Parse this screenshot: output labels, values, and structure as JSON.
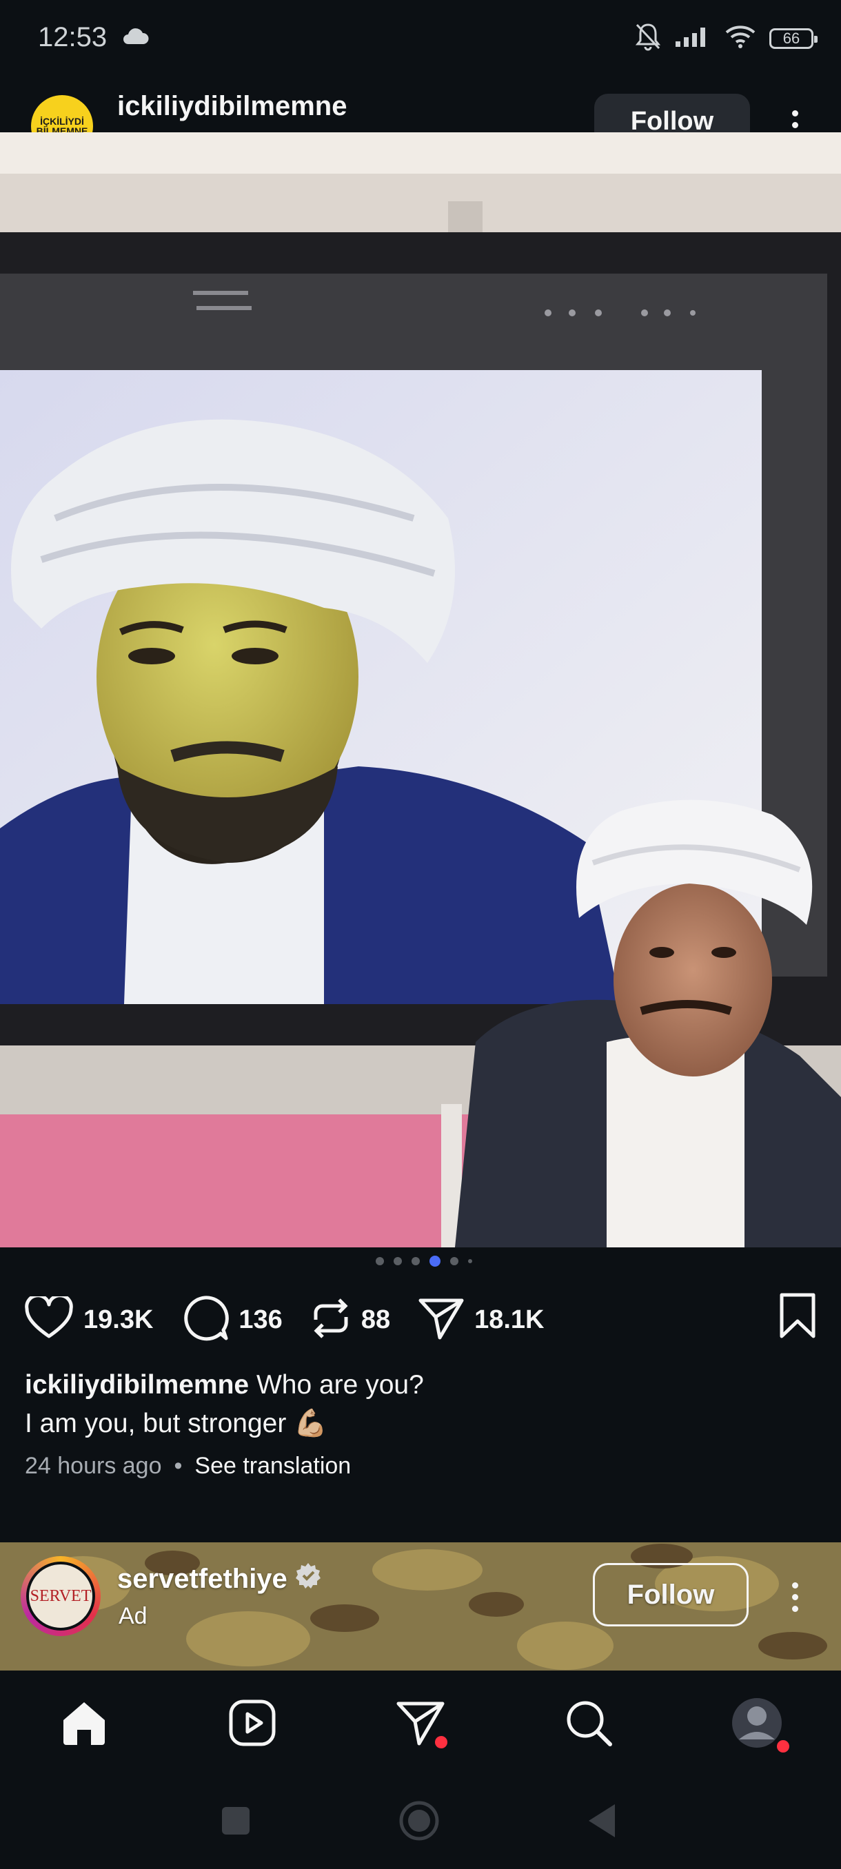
{
  "status_bar": {
    "time": "12:53",
    "battery": "66",
    "icons": [
      "cloud-icon",
      "bell-off-icon",
      "signal-icon",
      "wifi-icon",
      "battery-icon"
    ]
  },
  "post": {
    "avatar_text": "İÇKİLİYDİ BİLMEMNE",
    "username": "ickiliydibilmemne",
    "follow_label": "Follow",
    "carousel": {
      "total": 6,
      "active": 4
    },
    "likes": "19.3K",
    "comments": "136",
    "reposts": "88",
    "shares": "18.1K",
    "caption_user": "ickiliydibilmemne",
    "caption_line1": "Who are you?",
    "caption_line2": "I am you, but stronger",
    "caption_emoji": "💪🏼",
    "time_ago": "24 hours ago",
    "separator": "•",
    "see_translation": "See translation"
  },
  "ad": {
    "avatar_text": "SERVET",
    "username": "servetfethiye",
    "label": "Ad",
    "follow_label": "Follow"
  },
  "nav": {
    "items": [
      "home-icon",
      "reels-icon",
      "messages-icon",
      "search-icon",
      "profile-avatar"
    ]
  },
  "colors": {
    "background": "#0c1014",
    "accent_dot": "#4a6cf7",
    "notification": "#ff3040",
    "avatar_yellow": "#f7d11d"
  }
}
